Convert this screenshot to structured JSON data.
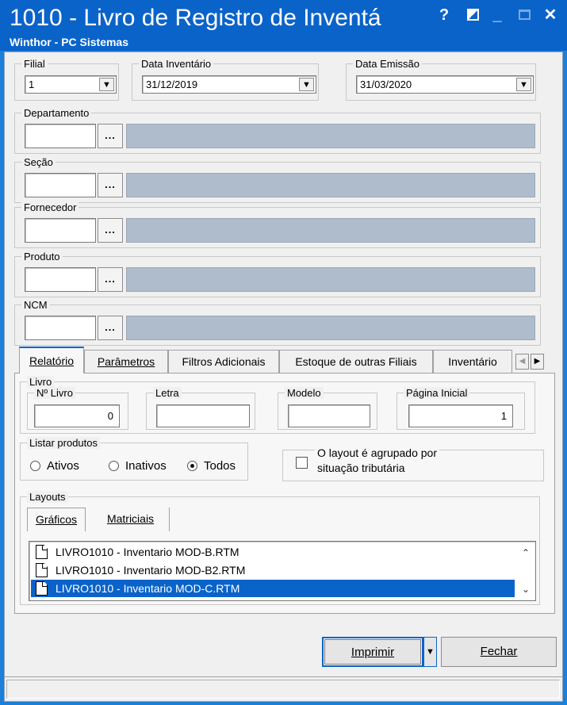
{
  "window": {
    "title": "1010 - Livro de Registro de Inventá",
    "subtitle": "Winthor - PC Sistemas",
    "help_glyph": "?",
    "min_glyph": "_",
    "close_glyph": "✕"
  },
  "filial": {
    "label": "Filial",
    "value": "1"
  },
  "data_inventario": {
    "label": "Data Inventário",
    "value": "31/12/2019"
  },
  "data_emissao": {
    "label": "Data Emissão",
    "value": "31/03/2020"
  },
  "lookups": {
    "departamento": {
      "label": "Departamento",
      "button": "..."
    },
    "secao": {
      "label": "Seção",
      "button": "..."
    },
    "fornecedor": {
      "label": "Fornecedor",
      "button": "..."
    },
    "produto": {
      "label": "Produto",
      "button": "..."
    },
    "ncm": {
      "label": "NCM",
      "button": "..."
    }
  },
  "tabs": {
    "items": [
      "Relatório",
      "Parâmetros",
      "Filtros Adicionais",
      "Estoque de outras Filiais",
      "Inventário"
    ],
    "active": "Relatório"
  },
  "livro": {
    "label": "Livro",
    "numero_label": "Nº Livro",
    "numero_value": "0",
    "letra_label": "Letra",
    "letra_value": "",
    "modelo_label": "Modelo",
    "modelo_value": "",
    "pagina_label": "Página Inicial",
    "pagina_value": "1"
  },
  "listar_produtos": {
    "label": "Listar produtos",
    "options": [
      "Ativos",
      "Inativos",
      "Todos"
    ],
    "selected": "Todos"
  },
  "agrupado": {
    "label_line1": "O layout é agrupado por",
    "label_line2": "situação tributária",
    "checked": false
  },
  "layouts": {
    "label": "Layouts",
    "subtabs": [
      "Gráficos",
      "Matriciais"
    ],
    "active_subtab": "Gráficos",
    "files": [
      "LIVRO1010 - Inventario MOD-B.RTM",
      "LIVRO1010 - Inventario MOD-B2.RTM",
      "LIVRO1010 - Inventario MOD-C.RTM"
    ],
    "selected_index": 2
  },
  "buttons": {
    "imprimir": "Imprimir",
    "fechar": "Fechar"
  },
  "icons": {
    "combo_arrow": "▼",
    "tab_left": "◀",
    "tab_right": "▶",
    "scroll_up": "⌃",
    "scroll_down": "⌄",
    "split_arrow": "▼"
  }
}
